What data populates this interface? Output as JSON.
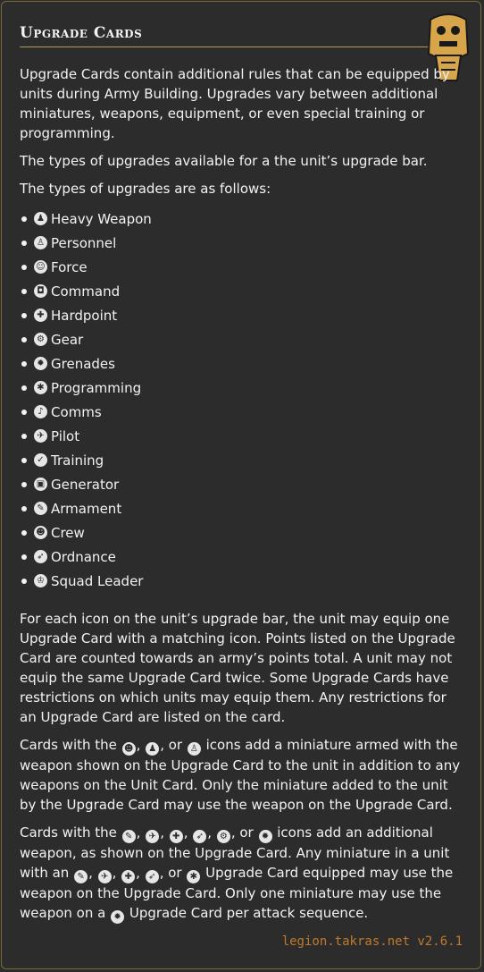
{
  "header": {
    "title": "Upgrade Cards"
  },
  "intro": [
    "Upgrade Cards contain additional rules that can be equipped by units during Army Building. Upgrades vary between additional miniatures, weapons, equipment, or even special training or programming.",
    "The types of upgrades available for a the unit’s upgrade bar.",
    "The types of upgrades are as follows:"
  ],
  "upgrades": [
    {
      "label": "Heavy Weapon",
      "icon": "heavy-weapon-icon"
    },
    {
      "label": "Personnel",
      "icon": "personnel-icon"
    },
    {
      "label": "Force",
      "icon": "force-icon"
    },
    {
      "label": "Command",
      "icon": "command-icon"
    },
    {
      "label": "Hardpoint",
      "icon": "hardpoint-icon"
    },
    {
      "label": "Gear",
      "icon": "gear-icon"
    },
    {
      "label": "Grenades",
      "icon": "grenades-icon"
    },
    {
      "label": "Programming",
      "icon": "programming-icon"
    },
    {
      "label": "Comms",
      "icon": "comms-icon"
    },
    {
      "label": "Pilot",
      "icon": "pilot-icon"
    },
    {
      "label": "Training",
      "icon": "training-icon"
    },
    {
      "label": "Generator",
      "icon": "generator-icon"
    },
    {
      "label": "Armament",
      "icon": "armament-icon"
    },
    {
      "label": "Crew",
      "icon": "crew-icon"
    },
    {
      "label": "Ordnance",
      "icon": "ordnance-icon"
    },
    {
      "label": "Squad Leader",
      "icon": "squad-leader-icon"
    }
  ],
  "para_equip": "For each icon on the unit’s upgrade bar, the unit may equip one Upgrade Card with a matching icon. Points listed on the Upgrade Card are counted towards an army’s points total. A unit may not equip the same Upgrade Card twice. Some Upgrade Cards have restrictions on which units may equip them. Any restrictions for an Upgrade Card are listed on the card.",
  "para_miniatures": {
    "lead": "Cards with the ",
    "sep1": ", ",
    "sep2": ", or ",
    "rest": " icons add a miniature armed with the weapon shown on the Upgrade Card to the unit in addition to any weapons on the Unit Card. Only the miniature added to the unit by the Upgrade Card may use the weapon on the Upgrade Card."
  },
  "para_weapons": {
    "lead": "Cards with the ",
    "comma": ", ",
    "or": ", or ",
    "mid": " icons add an additional weapon, as shown on the Upgrade Card. Any miniature in a unit with an ",
    "mid2": " Upgrade Card equipped may use the weapon on the Upgrade Card. Only one miniature may use the weapon on a ",
    "end": " Upgrade Card per attack sequence."
  },
  "footer": "legion.takras.net v2.6.1"
}
